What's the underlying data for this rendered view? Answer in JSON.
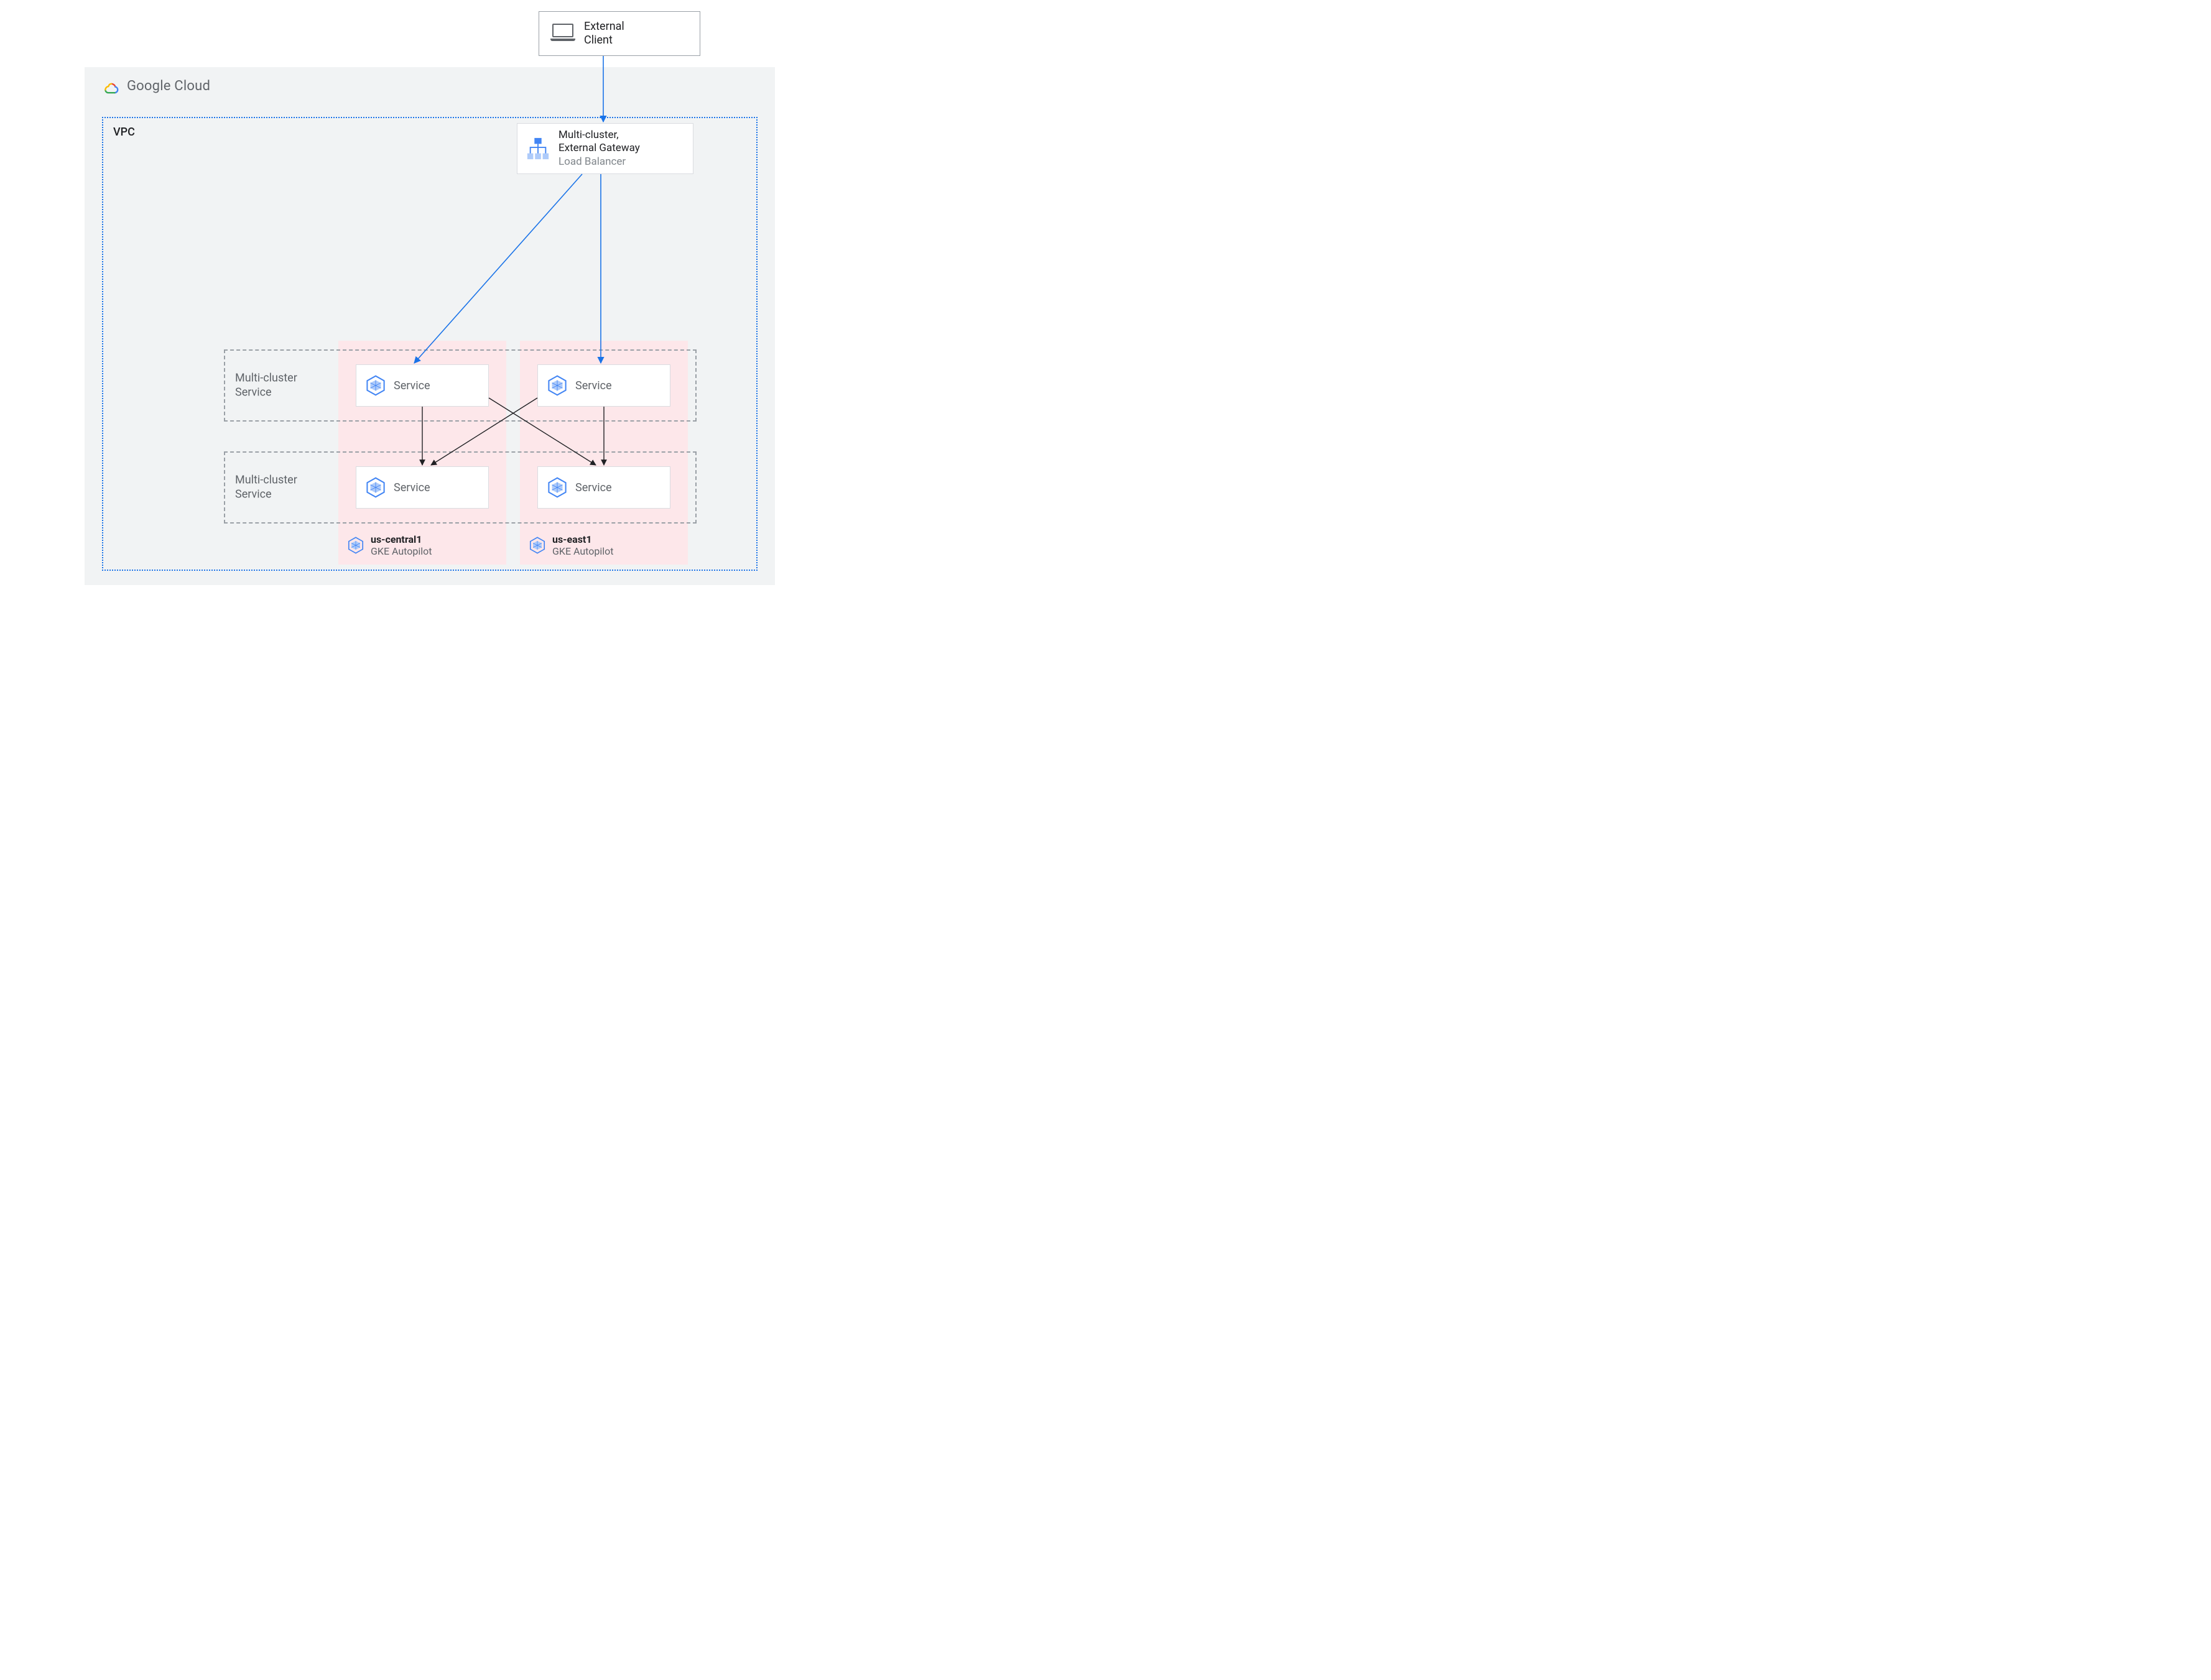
{
  "externalClient": {
    "line1": "External",
    "line2": "Client"
  },
  "cloud": {
    "title": "Google Cloud"
  },
  "vpc": {
    "label": "VPC"
  },
  "gateway": {
    "line1": "Multi-cluster,",
    "line2": "External Gateway",
    "sub": "Load Balancer"
  },
  "mcs": {
    "label1": "Multi-cluster",
    "label2": "Service"
  },
  "service": {
    "label": "Service"
  },
  "clusters": [
    {
      "name": "us-central1",
      "sub": "GKE Autopilot"
    },
    {
      "name": "us-east1",
      "sub": "GKE Autopilot"
    }
  ],
  "colors": {
    "blue": "#1a73e8",
    "pink": "#fde7ea",
    "grey": "#5f6368"
  }
}
